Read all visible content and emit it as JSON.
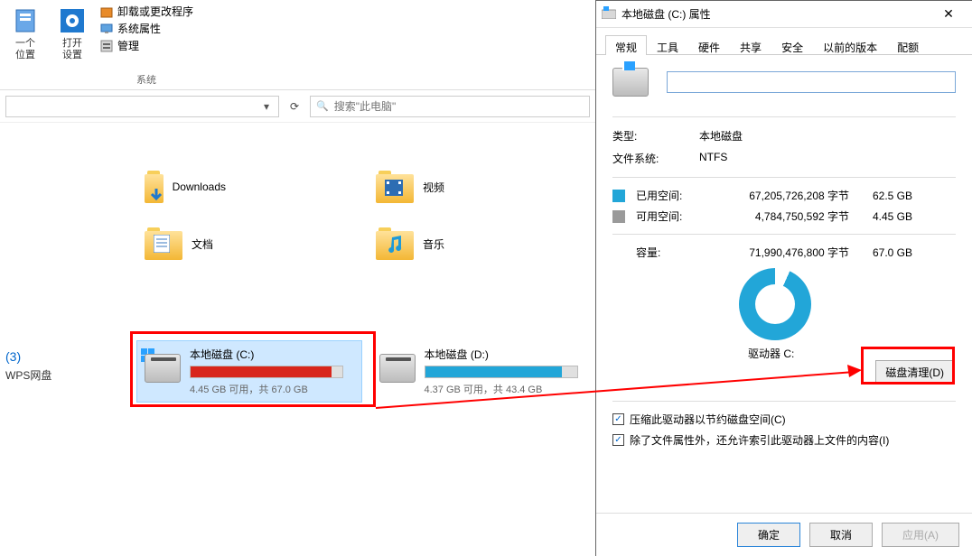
{
  "ribbon": {
    "prev_location_line1": "一个",
    "prev_location_line2": "位置",
    "open_settings_line1": "打开",
    "open_settings_line2": "设置",
    "uninstall_change": "卸载或更改程序",
    "system_props": "系统属性",
    "manage": "管理",
    "group_label": "系统"
  },
  "address": {
    "dropdown": "▾",
    "refresh": "⟳"
  },
  "search": {
    "icon_glyph": "🔍",
    "placeholder": "搜索\"此电脑\""
  },
  "folders": {
    "downloads": "Downloads",
    "videos": "视频",
    "documents": "文档",
    "music": "音乐"
  },
  "nav": {
    "section_count": "(3)",
    "wps": "WPS网盘"
  },
  "drives": {
    "c": {
      "name": "本地磁盘 (C:)",
      "stats": "4.45 GB 可用，共 67.0 GB",
      "fill_pct": 93,
      "fill_color": "#d8261c"
    },
    "d": {
      "name": "本地磁盘 (D:)",
      "stats": "4.37 GB 可用，共 43.4 GB",
      "fill_pct": 90,
      "fill_color": "#22a6d8"
    }
  },
  "dialog": {
    "title": "本地磁盘 (C:) 属性",
    "close": "✕",
    "tabs": [
      "常规",
      "工具",
      "硬件",
      "共享",
      "安全",
      "以前的版本",
      "配额"
    ],
    "active_tab_index": 0,
    "name_value": "",
    "type_label": "类型:",
    "type_value": "本地磁盘",
    "fs_label": "文件系统:",
    "fs_value": "NTFS",
    "used_label": "已用空间:",
    "used_bytes": "67,205,726,208 字节",
    "used_human": "62.5 GB",
    "used_color": "#22a6d8",
    "free_label": "可用空间:",
    "free_bytes": "4,784,750,592 字节",
    "free_human": "4.45 GB",
    "free_color": "#9a9a9a",
    "cap_label": "容量:",
    "cap_bytes": "71,990,476,800 字节",
    "cap_human": "67.0 GB",
    "drive_label": "驱动器 C:",
    "cleanup_btn": "磁盘清理(D)",
    "compress_chk": "压缩此驱动器以节约磁盘空间(C)",
    "index_chk": "除了文件属性外，还允许索引此驱动器上文件的内容(I)",
    "ok": "确定",
    "cancel": "取消",
    "apply": "应用(A)"
  }
}
